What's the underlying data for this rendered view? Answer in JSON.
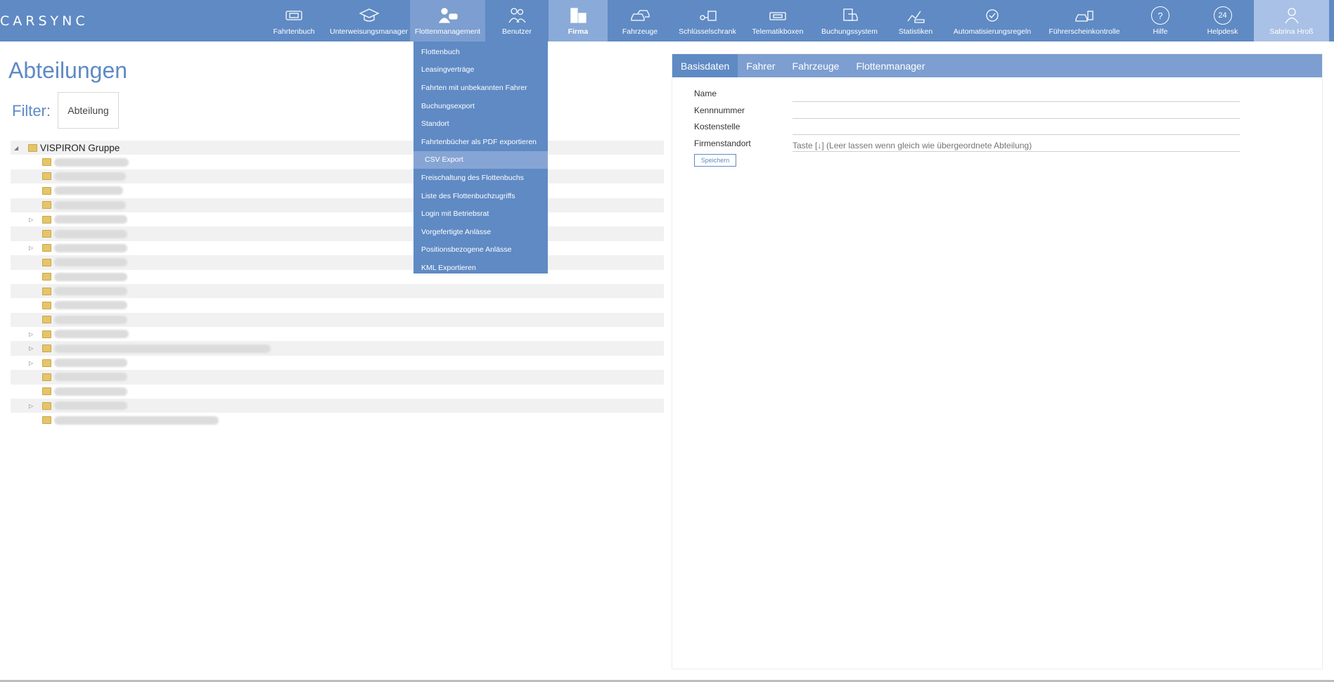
{
  "app": {
    "logo_text": "CARSYNC"
  },
  "nav": {
    "items": [
      {
        "label": "Fahrtenbuch",
        "icon": "logbook-icon"
      },
      {
        "label": "Unterweisungsmanager",
        "icon": "graduation-cap-icon"
      },
      {
        "label": "Flottenmanagement",
        "icon": "fleet-manager-icon"
      },
      {
        "label": "Benutzer",
        "icon": "users-icon"
      },
      {
        "label": "Firma",
        "icon": "building-icon"
      },
      {
        "label": "Fahrzeuge",
        "icon": "cars-icon"
      },
      {
        "label": "Schlüsselschrank",
        "icon": "key-cabinet-icon"
      },
      {
        "label": "Telematikboxen",
        "icon": "telematics-box-icon"
      },
      {
        "label": "Buchungssystem",
        "icon": "booking-icon"
      },
      {
        "label": "Statistiken",
        "icon": "statistics-icon"
      },
      {
        "label": "Automatisierungsregeln",
        "icon": "automation-icon"
      },
      {
        "label": "Führerscheinkontrolle",
        "icon": "license-check-icon"
      },
      {
        "label": "Hilfe",
        "icon": "help-icon",
        "glyph": "?"
      },
      {
        "label": "Helpdesk",
        "icon": "helpdesk-icon",
        "glyph": "24"
      },
      {
        "label": "Sabrina Hroß",
        "icon": "user-icon"
      }
    ]
  },
  "dropdown": {
    "items": [
      "Flottenbuch",
      "Leasingverträge",
      "Fahrten mit unbekannten Fahrer",
      "Buchungsexport",
      "Standort",
      "Fahrtenbücher als PDF exportieren",
      "CSV Export",
      "Freischaltung des Flottenbuchs",
      "Liste des Flottenbuchzugriffs",
      "Login mit Betriebsrat",
      "Vorgefertigte Anlässe",
      "Positionsbezogene Anlässe",
      "KML Exportieren"
    ]
  },
  "page": {
    "title": "Abteilungen",
    "filter_label": "Filter:",
    "filter_value": "Abteilung"
  },
  "tree": {
    "root_label": "VISPIRON Gruppe"
  },
  "detail": {
    "tabs": [
      "Basisdaten",
      "Fahrer",
      "Fahrzeuge",
      "Flottenmanager"
    ],
    "fields": [
      {
        "label": "Name",
        "value": ""
      },
      {
        "label": "Kennnummer",
        "value": ""
      },
      {
        "label": "Kostenstelle",
        "value": ""
      },
      {
        "label": "Firmenstandort",
        "placeholder": "Taste [↓] (Leer lassen wenn gleich wie übergeordnete Abteilung)"
      }
    ],
    "save_label": "Speichern"
  },
  "colors": {
    "primary": "#5f8ac4",
    "tab_bar": "#7c9ed0",
    "highlight": "#86a5d4"
  }
}
